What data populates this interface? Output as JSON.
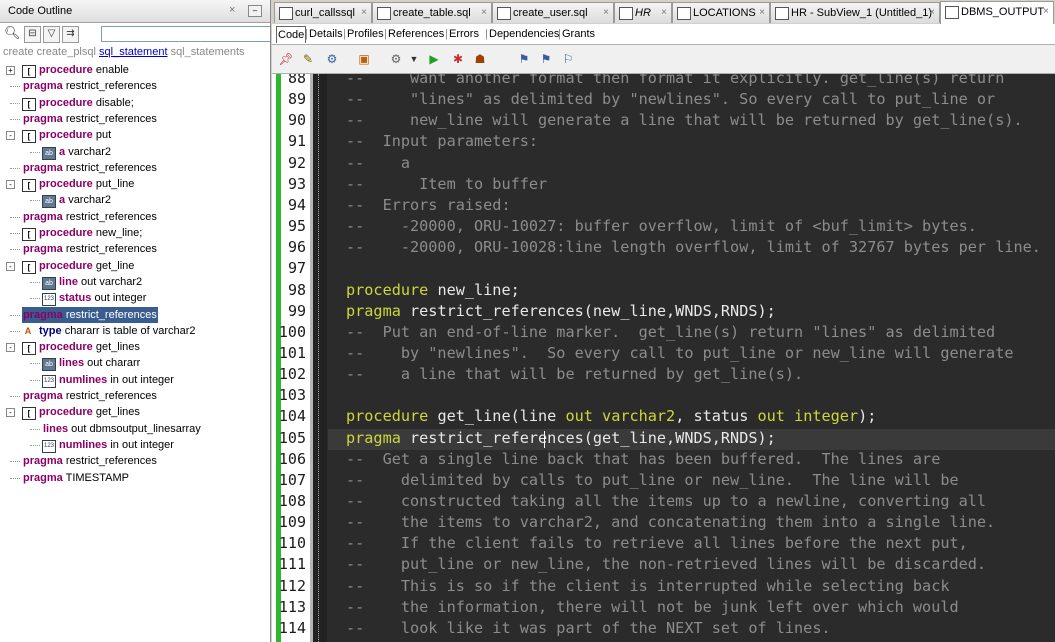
{
  "outline": {
    "title": "Code Outline",
    "close": "×",
    "min": "–",
    "filter_value": "",
    "path": {
      "p1": "create create_plsql",
      "p2": "sql_statement",
      "p3": "sql_statements"
    },
    "tools": [
      "magnify",
      "collapse",
      "filter",
      "sync"
    ],
    "items": [
      {
        "kw": "procedure",
        "text": "enable",
        "type": "proc",
        "exp": "+"
      },
      {
        "kw": "pragma",
        "text": "restrict_references",
        "type": "none"
      },
      {
        "kw": "procedure",
        "text": "disable;",
        "type": "proc"
      },
      {
        "kw": "pragma",
        "text": "restrict_references",
        "type": "none"
      },
      {
        "kw": "procedure",
        "text": "put",
        "type": "proc",
        "exp": "–"
      },
      {
        "kw": "a",
        "text": "varchar2",
        "type": "ab",
        "indent": 1
      },
      {
        "kw": "pragma",
        "text": "restrict_references",
        "type": "none"
      },
      {
        "kw": "procedure",
        "text": "put_line",
        "type": "proc",
        "exp": "–"
      },
      {
        "kw": "a",
        "text": "varchar2",
        "type": "ab",
        "indent": 1
      },
      {
        "kw": "pragma",
        "text": "restrict_references",
        "type": "none"
      },
      {
        "kw": "procedure",
        "text": "new_line;",
        "type": "proc"
      },
      {
        "kw": "pragma",
        "text": "restrict_references",
        "type": "none"
      },
      {
        "kw": "procedure",
        "text": "get_line",
        "type": "proc",
        "exp": "–"
      },
      {
        "kw": "line",
        "text": "out varchar2",
        "type": "ab",
        "indent": 1
      },
      {
        "kw": "status",
        "text": "out integer",
        "type": "num",
        "indent": 1
      },
      {
        "kw": "pragma",
        "text": "restrict_references",
        "type": "none",
        "selected": true
      },
      {
        "kw": "type",
        "text": "chararr is table of varchar2",
        "type": "typ",
        "kwclass": "kwb"
      },
      {
        "kw": "procedure",
        "text": "get_lines",
        "type": "proc",
        "exp": "–"
      },
      {
        "kw": "lines",
        "text": "out chararr",
        "type": "ab",
        "indent": 1
      },
      {
        "kw": "numlines",
        "text": "in out integer",
        "type": "num",
        "indent": 1
      },
      {
        "kw": "pragma",
        "text": "restrict_references",
        "type": "none"
      },
      {
        "kw": "procedure",
        "text": "get_lines",
        "type": "proc",
        "exp": "–"
      },
      {
        "kw": "lines",
        "text": "out dbmsoutput_linesarray",
        "type": "none",
        "indent": 1
      },
      {
        "kw": "numlines",
        "text": "in out integer",
        "type": "num",
        "indent": 1
      },
      {
        "kw": "pragma",
        "text": "restrict_references",
        "type": "none"
      },
      {
        "kw": "pragma",
        "text": "TIMESTAMP",
        "type": "none"
      }
    ]
  },
  "tabs": [
    {
      "label": "curl_callssql",
      "icon": "sql-file-icon"
    },
    {
      "label": "create_table.sql",
      "icon": "sql-file-icon"
    },
    {
      "label": "create_user.sql",
      "icon": "sql-file-icon"
    },
    {
      "label": "HR",
      "icon": "connection-icon",
      "italic": true
    },
    {
      "label": "LOCATIONS",
      "icon": "table-icon"
    },
    {
      "label": "HR - SubView_1 (Untitled_1)",
      "icon": "diagram-icon"
    },
    {
      "label": "DBMS_OUTPUT",
      "icon": "package-icon",
      "active": true
    }
  ],
  "subtabs": [
    "Code",
    "Details",
    "Profiles",
    "References",
    "Errors",
    "Dependencies",
    "Grants"
  ],
  "toolbar": [
    "pin-icon",
    "edit-icon",
    "compile-icon",
    "package-icon",
    "settings-icon",
    "run-icon",
    "debug-icon",
    "profile-icon",
    "bookmark-icon",
    "bookmark-next-icon",
    "bookmark-prev-icon"
  ],
  "editor": {
    "lines": [
      {
        "n": "88",
        "code": [
          [
            "c",
            "--     want another format then format it explicitly. get_line(s) return"
          ]
        ]
      },
      {
        "n": "89",
        "code": [
          [
            "c",
            "--     \"lines\" as delimited by \"newlines\". So every call to put_line or"
          ]
        ]
      },
      {
        "n": "90",
        "code": [
          [
            "c",
            "--     new_line will generate a line that will be returned by get_line(s)."
          ]
        ]
      },
      {
        "n": "91",
        "code": [
          [
            "c",
            "--  Input parameters:"
          ]
        ]
      },
      {
        "n": "92",
        "code": [
          [
            "c",
            "--    a"
          ]
        ]
      },
      {
        "n": "93",
        "code": [
          [
            "c",
            "--      Item to buffer"
          ]
        ]
      },
      {
        "n": "94",
        "code": [
          [
            "c",
            "--  Errors raised:"
          ]
        ]
      },
      {
        "n": "95",
        "code": [
          [
            "c",
            "--    -20000, ORU-10027: buffer overflow, limit of <buf_limit> bytes."
          ]
        ]
      },
      {
        "n": "96",
        "code": [
          [
            "c",
            "--    -20000, ORU-10028:line length overflow, limit of 32767 bytes per line."
          ]
        ]
      },
      {
        "n": "97",
        "code": []
      },
      {
        "n": "98",
        "code": [
          [
            "k",
            "procedure"
          ],
          [
            "t",
            " new_line;"
          ]
        ]
      },
      {
        "n": "99",
        "code": [
          [
            "k",
            "pragma"
          ],
          [
            "t",
            " restrict_references(new_line,WNDS,RNDS);"
          ]
        ]
      },
      {
        "n": "100",
        "code": [
          [
            "c",
            "--  Put an end-of-line marker.  get_line(s) return \"lines\" as delimited"
          ]
        ]
      },
      {
        "n": "101",
        "code": [
          [
            "c",
            "--    by \"newlines\".  So every call to put_line or new_line will generate"
          ]
        ]
      },
      {
        "n": "102",
        "code": [
          [
            "c",
            "--    a line that will be returned by get_line(s)."
          ]
        ]
      },
      {
        "n": "103",
        "code": []
      },
      {
        "n": "104",
        "code": [
          [
            "k",
            "procedure"
          ],
          [
            "t",
            " get_line(line "
          ],
          [
            "k",
            "out"
          ],
          [
            "t",
            " "
          ],
          [
            "k",
            "varchar2"
          ],
          [
            "t",
            ", status "
          ],
          [
            "k",
            "out"
          ],
          [
            "t",
            " "
          ],
          [
            "k",
            "integer"
          ],
          [
            "t",
            ");"
          ]
        ]
      },
      {
        "n": "105",
        "code": [
          [
            "k",
            "pragma"
          ],
          [
            "t",
            " restrict_references(get_line,WNDS,RNDS);"
          ]
        ],
        "current": true
      },
      {
        "n": "106",
        "code": [
          [
            "c",
            "--  Get a single line back that has been buffered.  The lines are"
          ]
        ]
      },
      {
        "n": "107",
        "code": [
          [
            "c",
            "--    delimited by calls to put_line or new_line.  The line will be"
          ]
        ]
      },
      {
        "n": "108",
        "code": [
          [
            "c",
            "--    constructed taking all the items up to a newline, converting all"
          ]
        ]
      },
      {
        "n": "109",
        "code": [
          [
            "c",
            "--    the items to varchar2, and concatenating them into a single line."
          ]
        ]
      },
      {
        "n": "110",
        "code": [
          [
            "c",
            "--    If the client fails to retrieve all lines before the next put,"
          ]
        ]
      },
      {
        "n": "111",
        "code": [
          [
            "c",
            "--    put_line or new_line, the non-retrieved lines will be discarded."
          ]
        ]
      },
      {
        "n": "112",
        "code": [
          [
            "c",
            "--    This is so if the client is interrupted while selecting back"
          ]
        ]
      },
      {
        "n": "113",
        "code": [
          [
            "c",
            "--    the information, there will not be junk left over which would"
          ]
        ]
      },
      {
        "n": "114",
        "code": [
          [
            "c",
            "--    look like it was part of the NEXT set of lines."
          ]
        ]
      }
    ]
  }
}
